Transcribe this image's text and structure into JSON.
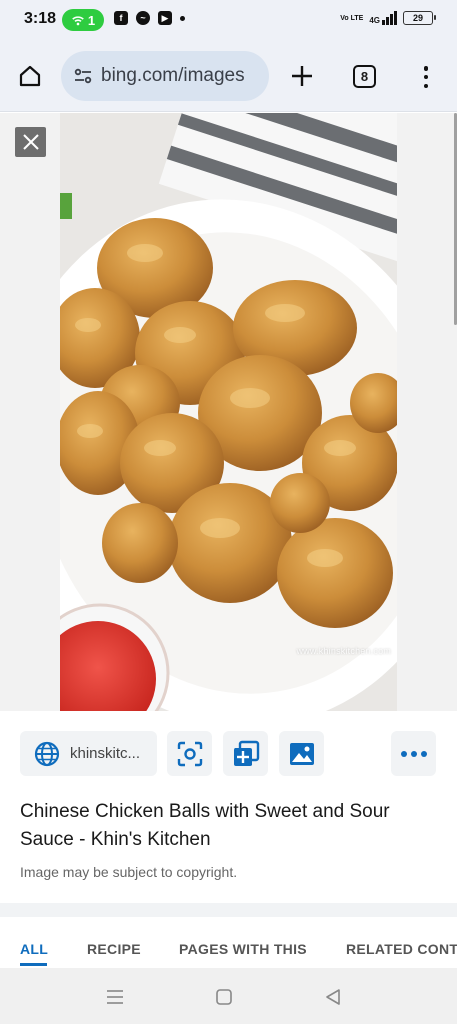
{
  "status_bar": {
    "time": "3:18",
    "hotspot_count": "1",
    "volte": "Vo LTE",
    "network": "4G",
    "battery": "29"
  },
  "toolbar": {
    "url": "bing.com/images",
    "tab_count": "8"
  },
  "viewer": {
    "watermark": "www.khinskitchen.com",
    "description_colors": {
      "background": "#f2f2f2",
      "chicken": "#c98a35",
      "sauce": "#e23b2e"
    }
  },
  "result": {
    "source_label": "khinskitc...",
    "title": "Chinese Chicken Balls with Sweet and Sour Sauce - Khin's Kitchen",
    "copyright": "Image may be subject to copyright."
  },
  "tabs": [
    {
      "label": "ALL",
      "active": true
    },
    {
      "label": "RECIPE",
      "active": false
    },
    {
      "label": "PAGES WITH THIS",
      "active": false
    },
    {
      "label": "RELATED CONTENT",
      "active": false
    }
  ],
  "colors": {
    "accent": "#0f6cbd",
    "chrome": "#eef1f7",
    "url_pill": "#d9e3f0"
  }
}
